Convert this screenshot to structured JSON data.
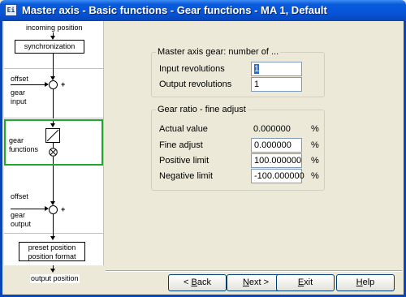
{
  "window": {
    "title": "Master axis - Basic functions - Gear functions - MA 1,  Default",
    "icon_text": "Ei"
  },
  "diagram": {
    "incoming_position": "incoming position",
    "synchronization": "synchronization",
    "offset_1": "offset",
    "gear_input_1": "gear",
    "gear_input_2": "input",
    "gear_functions_1": "gear",
    "gear_functions_2": "functions",
    "offset_2": "offset",
    "gear_output_1": "gear",
    "gear_output_2": "output",
    "preset_position": "preset position",
    "position_format": "position format",
    "output_position": "output position",
    "plus": "+",
    "selected_color": "#1fa82a"
  },
  "gear_group": {
    "legend": "Master axis gear: number of ...",
    "input_label": "Input revolutions",
    "input_value": "1",
    "output_label": "Output revolutions",
    "output_value": "1"
  },
  "ratio_group": {
    "legend": "Gear ratio - fine adjust",
    "actual_label": "Actual value",
    "actual_value": "0.000000",
    "fine_label": "Fine adjust",
    "fine_value": "0.000000",
    "pos_label": "Positive limit",
    "pos_value": "100.000000",
    "neg_label": "Negative limit",
    "neg_value": "-100.000000",
    "unit": "%"
  },
  "buttons": {
    "back_prefix": "< ",
    "back_hot": "B",
    "back_rest": "ack",
    "next_hot": "N",
    "next_rest": "ext >",
    "exit_hot": "E",
    "exit_rest": "xit",
    "help_hot": "H",
    "help_rest": "elp"
  }
}
